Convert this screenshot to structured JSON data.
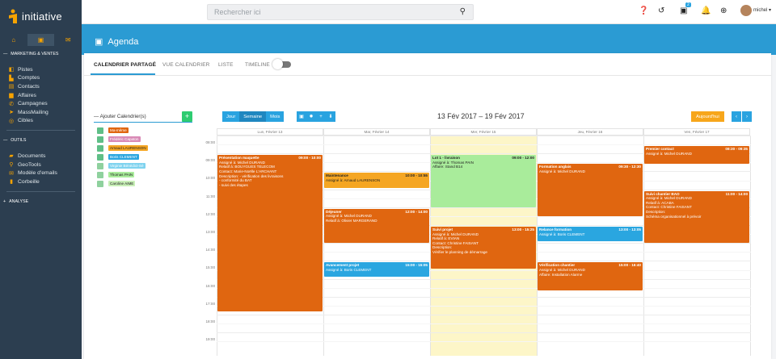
{
  "app": {
    "brand": "initiative"
  },
  "topbar": {
    "search_placeholder": "Rechercher ici",
    "badge_count": "2",
    "user_name": "michel"
  },
  "sidebar": {
    "sections": [
      {
        "label": "MARKETING & VENTES",
        "items": [
          "Pistes",
          "Comptes",
          "Contacts",
          "Affaires",
          "Campagnes",
          "MassMailing",
          "Cibles"
        ]
      },
      {
        "label": "OUTILS",
        "items": [
          "Documents",
          "GeoTools",
          "Modèle d'emails",
          "Corbeille"
        ]
      },
      {
        "label": "ANALYSE",
        "items": []
      }
    ]
  },
  "page": {
    "title": "Agenda"
  },
  "tabs": [
    "CALENDRIER PARTAGÉ",
    "VUE CALENDRIER",
    "LISTE",
    "TIMELINE"
  ],
  "calendars": {
    "add_label": "Ajouter Calendrier(s)",
    "items": [
      {
        "label": "Ma-même",
        "color": "#e06610"
      },
      {
        "label": "Frédéric Capaton",
        "color": "#d98ab6"
      },
      {
        "label": "Arnaud LAURENSON",
        "color": "#f5a623"
      },
      {
        "label": "Boris CLEMENT",
        "color": "#2aa6e0"
      },
      {
        "label": "Virginie Bénédict-Sé",
        "color": "#7fd3ef"
      },
      {
        "label": "Thomas PAIN",
        "color": "#a9ec9b"
      },
      {
        "label": "Caroline AIME",
        "color": "#c9f0b8"
      }
    ]
  },
  "toolbar": {
    "views": [
      "Jour",
      "Semaine",
      "Mois"
    ],
    "range": "13 Fév 2017 – 19 Fév 2017",
    "today": "Aujourd'hui"
  },
  "week": {
    "days": [
      "Lun, Février 13",
      "Mar, Février 14",
      "Mer, Février 15",
      "Jeu, Février 16",
      "Ven, Février 17"
    ],
    "hours": [
      "08:00",
      "09:00",
      "10:00",
      "11:00",
      "12:00",
      "13:00",
      "14:00",
      "15:00",
      "16:00",
      "17:00",
      "18:00",
      "19:00"
    ]
  },
  "events": [
    {
      "id": "e1",
      "title": "Présentation maquette",
      "time": "09:00 - 10:00",
      "lines": [
        "Assigné à: Michel DURAND",
        "Relatif à: BOUYGUES TELECOM",
        "Contact: Marie-Noëlle L'ARCHANT",
        "Description: - vérification des livraisons",
        "- conformité du BAT",
        "- suivi des étapes"
      ]
    },
    {
      "id": "e2",
      "title": "Maintenance",
      "time": "10:00 - 10:55",
      "lines": [
        "Assigné à: Arnaud LAURENSON"
      ]
    },
    {
      "id": "e3",
      "title": "Déjeuner",
      "time": "12:00 - 14:00",
      "lines": [
        "Assigné à: Michel DURAND",
        "Relatif à: Olivier MARGERAND"
      ]
    },
    {
      "id": "e4",
      "title": "Avancement projet",
      "time": "15:00 - 15:05",
      "lines": [
        "Assigné à: Boris CLEMENT"
      ]
    },
    {
      "id": "e5",
      "title": "Lot 1 - livraison",
      "time": "09:00 - 12:00",
      "lines": [
        "Assigné à: Thomas PAIN",
        "Affaire: Stand B14"
      ]
    },
    {
      "id": "e6",
      "title": "Suivi projet",
      "time": "13:00 - 15:25",
      "lines": [
        "Assigné à: Michel DURAND",
        "Relatif à: EVIAN",
        "Contact: Christine FAISANT",
        "Description:",
        "Vérifier le planning de démarrage"
      ]
    },
    {
      "id": "e7",
      "title": "Formation anglais",
      "time": "09:30 - 12:30",
      "lines": [
        "Assigné à: Michel DURAND"
      ]
    },
    {
      "id": "e8",
      "title": "Relance formation",
      "time": "13:00 - 13:05",
      "lines": [
        "Assigné à: Boris CLEMENT"
      ]
    },
    {
      "id": "e9",
      "title": "Vérification chantier",
      "time": "15:00 - 16:40",
      "lines": [
        "Assigné à: Michel DURAND",
        "Affaire: Installation Alarme"
      ]
    },
    {
      "id": "e10",
      "title": "Premier contact",
      "time": "08:30 - 09:35",
      "lines": [
        "Assigné à: Michel DURAND"
      ]
    },
    {
      "id": "e11",
      "title": "Suivi chantier BAO",
      "time": "11:00 - 14:00",
      "lines": [
        "Assigné à: Michel DURAND",
        "Relatif à: ACABA",
        "Contact: Christine FAISANT",
        "Description:",
        "Schéma organisationnel à prévoir"
      ]
    }
  ]
}
